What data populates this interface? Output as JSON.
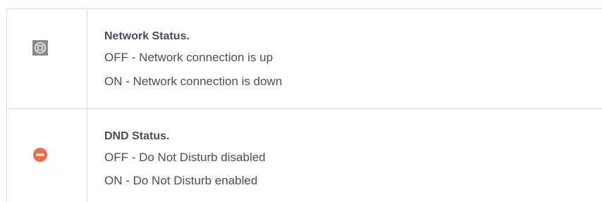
{
  "network": {
    "icon": "network-status-icon",
    "title": "Network Status.",
    "off_text": "OFF - Network connection is up",
    "on_text": "ON - Network connection is down"
  },
  "dnd": {
    "icon": "dnd-icon",
    "title": "DND Status.",
    "off_text": "OFF - Do Not Disturb disabled",
    "on_text": "ON - Do Not Disturb enabled"
  },
  "colors": {
    "text": "#4a4e5a",
    "border": "#dcdcdc",
    "network_icon_bg": "#8a8a8a",
    "dnd_icon": "#ef6a4a"
  }
}
